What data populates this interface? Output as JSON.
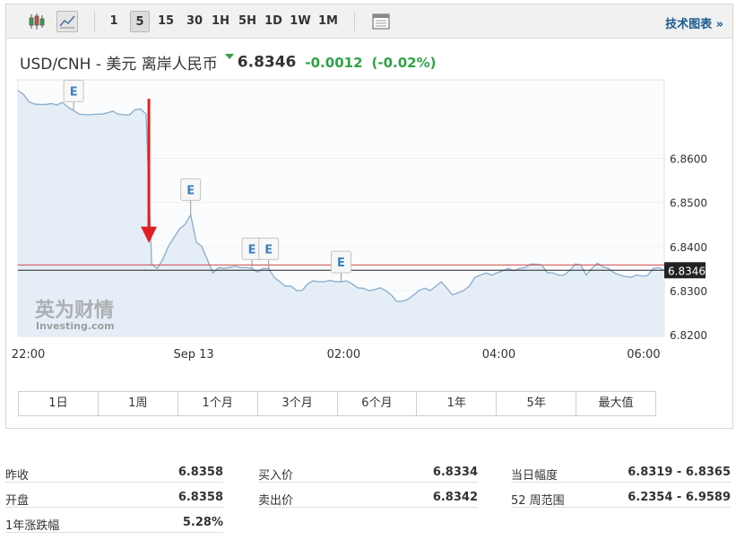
{
  "toolbar": {
    "intervals": [
      "1",
      "5",
      "15",
      "30",
      "1H",
      "5H",
      "1D",
      "1W",
      "1M"
    ],
    "active_interval": "5",
    "tech_chart_link": "技术图表 »"
  },
  "quote": {
    "name": "USD/CNH - 美元 离岸人民币",
    "price": "6.8346",
    "change": "-0.0012",
    "change_pct": "(-0.02%)"
  },
  "colors": {
    "up_green": "#2ea347",
    "line_blue": "#8fb0cf",
    "area_fill": "#e5eef6",
    "arrow_red": "#e02020",
    "prev_close_line": "#d04a4a",
    "current_line": "#222222",
    "link_blue": "#1a5a8e"
  },
  "chart_data": {
    "type": "area",
    "x_ticks": [
      "22:00",
      "Sep 13",
      "02:00",
      "04:00",
      "06:00"
    ],
    "y_ticks": [
      "6.8600",
      "6.8500",
      "6.8400",
      "6.8300",
      "6.8200"
    ],
    "ylim": [
      6.8196,
      6.8778
    ],
    "current_label": "6.8346",
    "current_value": 6.8346,
    "prev_close": 6.8358,
    "watermark": [
      "英为财情",
      "Investing.com"
    ],
    "event_markers": [
      {
        "label": "E",
        "at_index": 10
      },
      {
        "label": "E",
        "at_index": 31
      },
      {
        "label": "E",
        "at_index": 42
      },
      {
        "label": "E",
        "at_index": 45
      },
      {
        "label": "E",
        "at_index": 58
      }
    ],
    "series": [
      {
        "values": [
          6.8754,
          6.8745,
          6.8728,
          6.8723,
          6.8722,
          6.8722,
          6.8724,
          6.8721,
          6.8727,
          6.8716,
          6.8708,
          6.87,
          6.8699,
          6.8699,
          6.87,
          6.87,
          6.8703,
          6.8707,
          6.87,
          6.8699,
          6.8698,
          6.871,
          6.8712,
          6.87,
          6.836,
          6.835,
          6.8371,
          6.84,
          6.842,
          6.844,
          6.845,
          6.8472,
          6.841,
          6.84,
          6.837,
          6.834,
          6.8352,
          6.835,
          6.8353,
          6.8355,
          6.8352,
          6.8352,
          6.835,
          6.8342,
          6.835,
          6.835,
          6.833,
          6.832,
          6.831,
          6.831,
          6.83,
          6.83,
          6.8315,
          6.8322,
          6.832,
          6.832,
          6.8323,
          6.832,
          6.832,
          6.8322,
          6.8315,
          6.8306,
          6.8305,
          6.83,
          6.8302,
          6.8306,
          6.83,
          6.829,
          6.8275,
          6.8276,
          6.828,
          6.829,
          6.83,
          6.8305,
          6.83,
          6.831,
          6.832,
          6.8305,
          6.829,
          6.8295,
          6.83,
          6.831,
          6.833,
          6.8335,
          6.834,
          6.8335,
          6.834,
          6.8345,
          6.835,
          6.8345,
          6.835,
          6.8352,
          6.836,
          6.836,
          6.8358,
          6.834,
          6.834,
          6.8335,
          6.8335,
          6.8345,
          6.836,
          6.8358,
          6.8335,
          6.835,
          6.8362,
          6.8354,
          6.835,
          6.834,
          6.8335,
          6.8332,
          6.833,
          6.8335,
          6.8333,
          6.8334,
          6.835,
          6.8352,
          6.8346
        ]
      }
    ]
  },
  "range_buttons": [
    "1日",
    "1周",
    "1个月",
    "3个月",
    "6个月",
    "1年",
    "5年",
    "最大值"
  ],
  "stats": {
    "col1": [
      {
        "label": "昨收",
        "value": "6.8358"
      },
      {
        "label": "开盘",
        "value": "6.8358"
      },
      {
        "label": "1年涨跌幅",
        "value": "5.28%"
      }
    ],
    "col2": [
      {
        "label": "买入价",
        "value": "6.8334"
      },
      {
        "label": "卖出价",
        "value": "6.8342"
      }
    ],
    "col3": [
      {
        "label": "当日幅度",
        "value": "6.8319 - 6.8365"
      },
      {
        "label": "52 周范围",
        "value": "6.2354 - 6.9589"
      }
    ]
  }
}
